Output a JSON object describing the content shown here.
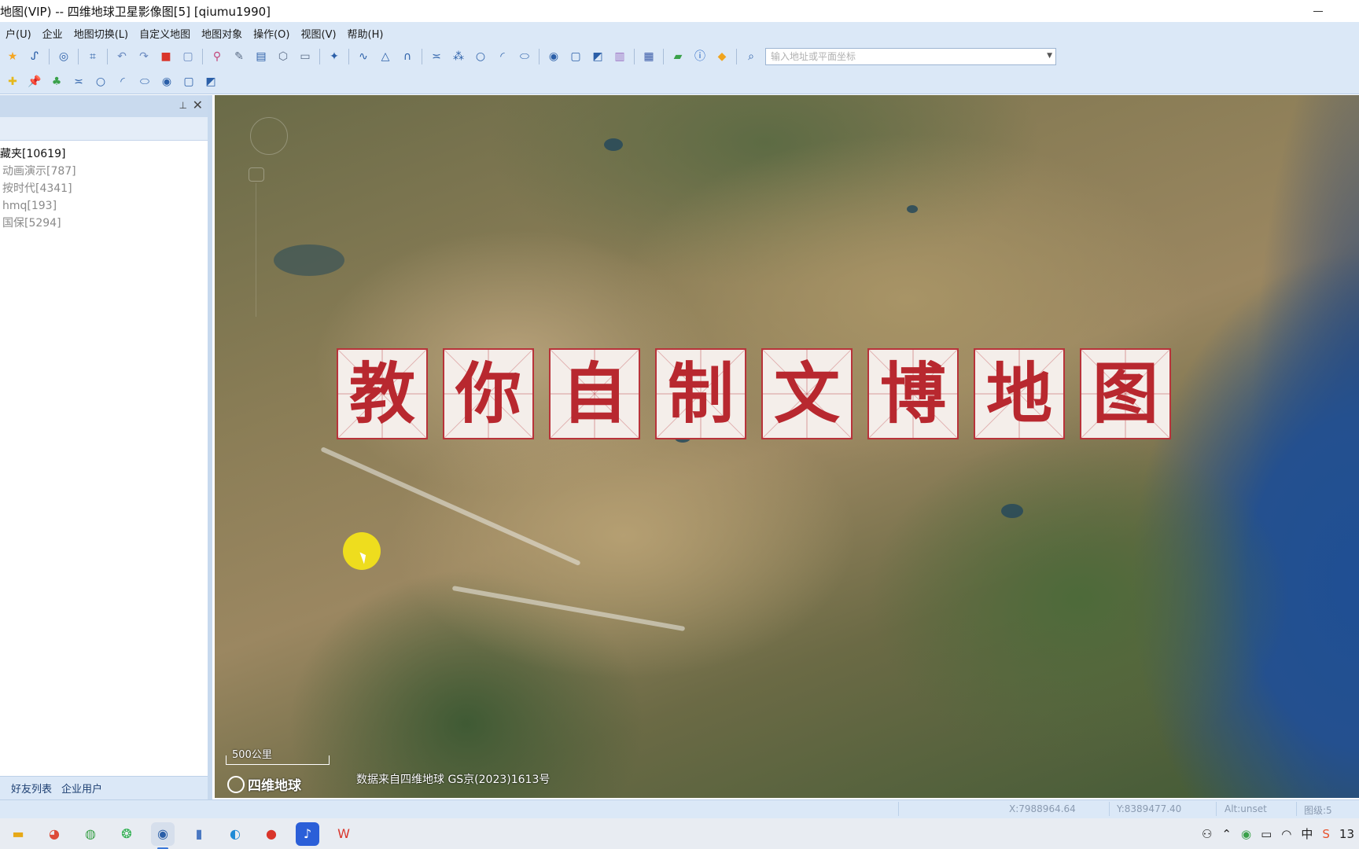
{
  "window": {
    "title": "地图(VIP) -- 四维地球卫星影像图[5] [qiumu1990]"
  },
  "menu": [
    "户(U)",
    "企业",
    "地图切换(L)",
    "自定义地图",
    "地图对象",
    "操作(O)",
    "视图(V)",
    "帮助(H)"
  ],
  "search": {
    "placeholder": "输入地址或平面坐标"
  },
  "left_panel": {
    "tree": [
      {
        "label": "藏夹[10619]",
        "level": "root"
      },
      {
        "label": "动画演示[787]",
        "level": "child"
      },
      {
        "label": "按时代[4341]",
        "level": "child"
      },
      {
        "label": "hmq[193]",
        "level": "child"
      },
      {
        "label": "国保[5294]",
        "level": "child"
      }
    ],
    "footer_tabs": [
      "好友列表",
      "企业用户"
    ]
  },
  "map": {
    "banner": [
      "教",
      "你",
      "自",
      "制",
      "文",
      "博",
      "地",
      "图"
    ],
    "scale_label": "500公里",
    "logo_text": "四维地球",
    "credit": "数据来自四维地球 GS京(2023)1613号"
  },
  "status": {
    "x": "X:7988964.64",
    "y": "Y:8389477.40",
    "alt": "Alt:unset",
    "level": "图级:5"
  },
  "taskbar": {
    "tray_ime": "中",
    "tray_clock": "13"
  },
  "colors": {
    "chrome_bg": "#dbe8f7",
    "banner_red": "#b8282f",
    "banner_bg": "#f4eeea",
    "cursor_highlight": "#f2e21a"
  }
}
